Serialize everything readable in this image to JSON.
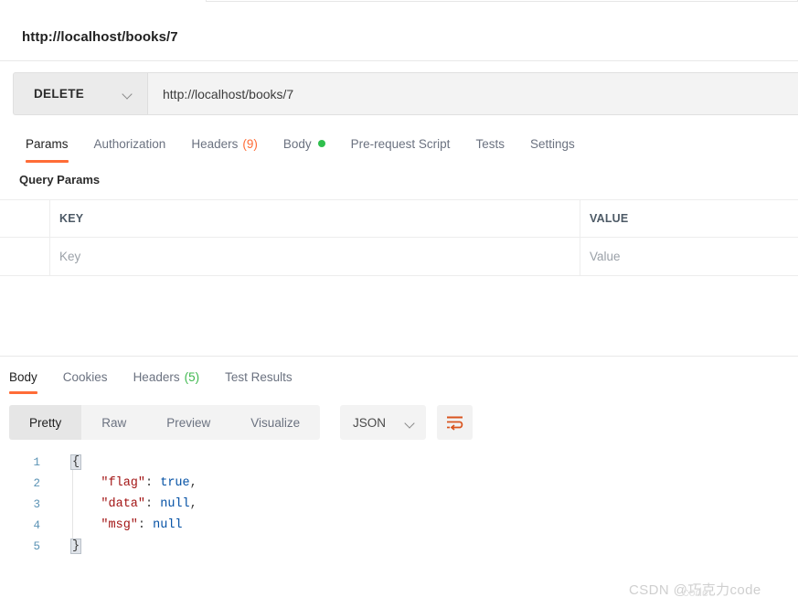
{
  "request": {
    "title": "http://localhost/books/7",
    "method": "DELETE",
    "url": "http://localhost/books/7",
    "tabs": [
      {
        "label": "Params",
        "active": true,
        "count": null,
        "dot": false
      },
      {
        "label": "Authorization",
        "active": false,
        "count": null,
        "dot": false
      },
      {
        "label": "Headers",
        "active": false,
        "count": "(9)",
        "dot": false
      },
      {
        "label": "Body",
        "active": false,
        "count": null,
        "dot": true
      },
      {
        "label": "Pre-request Script",
        "active": false,
        "count": null,
        "dot": false
      },
      {
        "label": "Tests",
        "active": false,
        "count": null,
        "dot": false
      },
      {
        "label": "Settings",
        "active": false,
        "count": null,
        "dot": false
      }
    ],
    "query_params": {
      "section_label": "Query Params",
      "columns": [
        "KEY",
        "VALUE"
      ],
      "rows": [
        {
          "key_placeholder": "Key",
          "value_placeholder": "Value"
        }
      ]
    }
  },
  "response": {
    "tabs": [
      {
        "label": "Body",
        "active": true,
        "count": null
      },
      {
        "label": "Cookies",
        "active": false,
        "count": null
      },
      {
        "label": "Headers",
        "active": false,
        "count": "(5)"
      },
      {
        "label": "Test Results",
        "active": false,
        "count": null
      }
    ],
    "format_buttons": [
      {
        "label": "Pretty",
        "active": true
      },
      {
        "label": "Raw",
        "active": false
      },
      {
        "label": "Preview",
        "active": false
      },
      {
        "label": "Visualize",
        "active": false
      }
    ],
    "language": "JSON",
    "wrap_icon": "word-wrap-icon",
    "body_lines": [
      {
        "num": "1",
        "segments": [
          {
            "t": "{",
            "c": "brace-hl"
          }
        ]
      },
      {
        "num": "2",
        "segments": [
          {
            "t": "    ",
            "c": "p"
          },
          {
            "t": "\"flag\"",
            "c": "k"
          },
          {
            "t": ": ",
            "c": "p"
          },
          {
            "t": "true",
            "c": "b"
          },
          {
            "t": ",",
            "c": "p"
          }
        ]
      },
      {
        "num": "3",
        "segments": [
          {
            "t": "    ",
            "c": "p"
          },
          {
            "t": "\"data\"",
            "c": "k"
          },
          {
            "t": ": ",
            "c": "p"
          },
          {
            "t": "null",
            "c": "b"
          },
          {
            "t": ",",
            "c": "p"
          }
        ]
      },
      {
        "num": "4",
        "segments": [
          {
            "t": "    ",
            "c": "p"
          },
          {
            "t": "\"msg\"",
            "c": "k"
          },
          {
            "t": ": ",
            "c": "p"
          },
          {
            "t": "null",
            "c": "b"
          }
        ]
      },
      {
        "num": "5",
        "segments": [
          {
            "t": "}",
            "c": "brace-hl"
          }
        ]
      }
    ]
  },
  "watermark": {
    "text": "CSDN @巧克力code",
    "ghost": "code"
  },
  "colors": {
    "accent_orange": "#ff6c37",
    "green_dot": "#2fbf4d",
    "green_count": "#3fb84f",
    "json_key": "#a31515",
    "json_value": "#0451a5",
    "gutter": "#5b93b5"
  }
}
